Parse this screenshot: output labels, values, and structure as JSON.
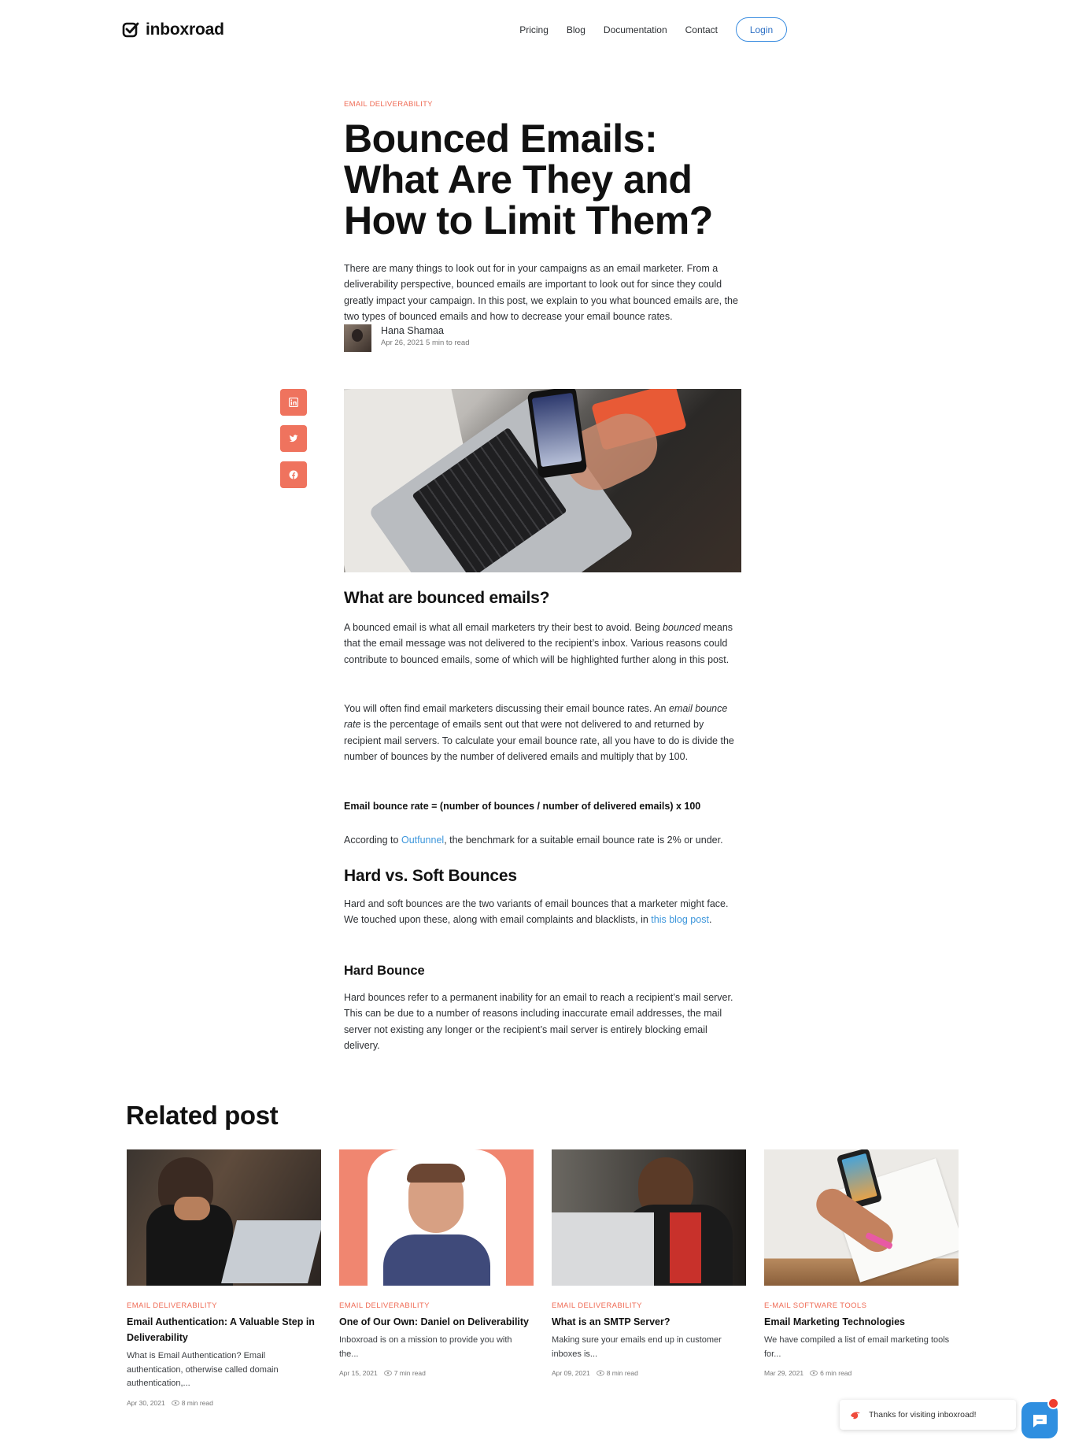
{
  "header": {
    "logo_text": "inboxroad",
    "nav": [
      "Pricing",
      "Blog",
      "Documentation",
      "Contact"
    ],
    "login_label": "Login"
  },
  "article": {
    "category": "EMAIL DELIVERABILITY",
    "title": "Bounced Emails: What Are They and How to Limit Them?",
    "intro": "There are many things to look out for in your campaigns as an email marketer. From a deliverability perspective, bounced emails are important to look out for since they could greatly impact your campaign. In this post, we explain to you what bounced emails are, the two types of bounced emails and how to decrease your email bounce rates.",
    "author": {
      "name": "Hana Shamaa",
      "meta": "Apr 26, 2021 5 min to read"
    },
    "share": [
      "linkedin-icon",
      "twitter-icon",
      "facebook-icon"
    ],
    "sections": {
      "what_heading": "What are bounced emails?",
      "what_p1_a": "A bounced email is what all email marketers try their best to avoid. Being ",
      "what_p1_em": "bounced",
      "what_p1_b": " means that the email message was not delivered to the recipient’s inbox. Various reasons could contribute to bounced emails, some of which will be highlighted further along in this post.",
      "what_p2_a": "You will often find email marketers discussing their email bounce rates. An ",
      "what_p2_em": "email bounce rate",
      "what_p2_b": " is the percentage of emails sent out that were not delivered to and returned by recipient mail servers. To calculate your email bounce rate, all you have to do is divide the number of bounces by the number of delivered emails and multiply that by 100.",
      "formula": "Email bounce rate = (number of bounces / number of delivered emails) x 100",
      "benchmark_a": "According to ",
      "benchmark_link": "Outfunnel",
      "benchmark_b": ", the benchmark for a suitable email bounce rate is 2% or under.",
      "hard_soft_heading": "Hard vs. Soft Bounces",
      "hard_soft_p_a": "Hard and soft bounces are the two variants of email bounces that a marketer might face. We touched upon these, along with email complaints and blacklists, in ",
      "hard_soft_link": "this blog post",
      "hard_soft_p_b": ".",
      "hard_heading": "Hard Bounce",
      "hard_p": "Hard bounces refer to a permanent inability for an email to reach a recipient’s mail server. This can be due to a number of reasons including inaccurate email addresses, the mail server not existing any longer or the recipient’s mail server is entirely blocking email delivery."
    }
  },
  "related": {
    "heading": "Related post",
    "posts": [
      {
        "category": "EMAIL DELIVERABILITY",
        "title": "Email Authentication: A Valuable Step in Deliverability",
        "excerpt": "What is Email Authentication? Email authentication, otherwise called domain authentication,...",
        "date": "Apr 30, 2021",
        "read": "8 min read"
      },
      {
        "category": "EMAIL DELIVERABILITY",
        "title": "One of Our Own: Daniel on Deliverability",
        "excerpt": "Inboxroad is on a mission to provide you with the...",
        "date": "Apr 15, 2021",
        "read": "7 min read"
      },
      {
        "category": "EMAIL DELIVERABILITY",
        "title": "What is an SMTP Server?",
        "excerpt": "Making sure your emails end up in customer inboxes is...",
        "date": "Apr 09, 2021",
        "read": "8 min read"
      },
      {
        "category": "E-MAIL SOFTWARE TOOLS",
        "title": "Email Marketing Technologies",
        "excerpt": "We have compiled a list of email marketing tools for...",
        "date": "Mar 29, 2021",
        "read": "6 min read"
      }
    ]
  },
  "chat": {
    "message": "Thanks for visiting inboxroad!"
  },
  "colors": {
    "accent": "#ef6b55",
    "link": "#3d96db",
    "chat": "#2f8fe0"
  }
}
